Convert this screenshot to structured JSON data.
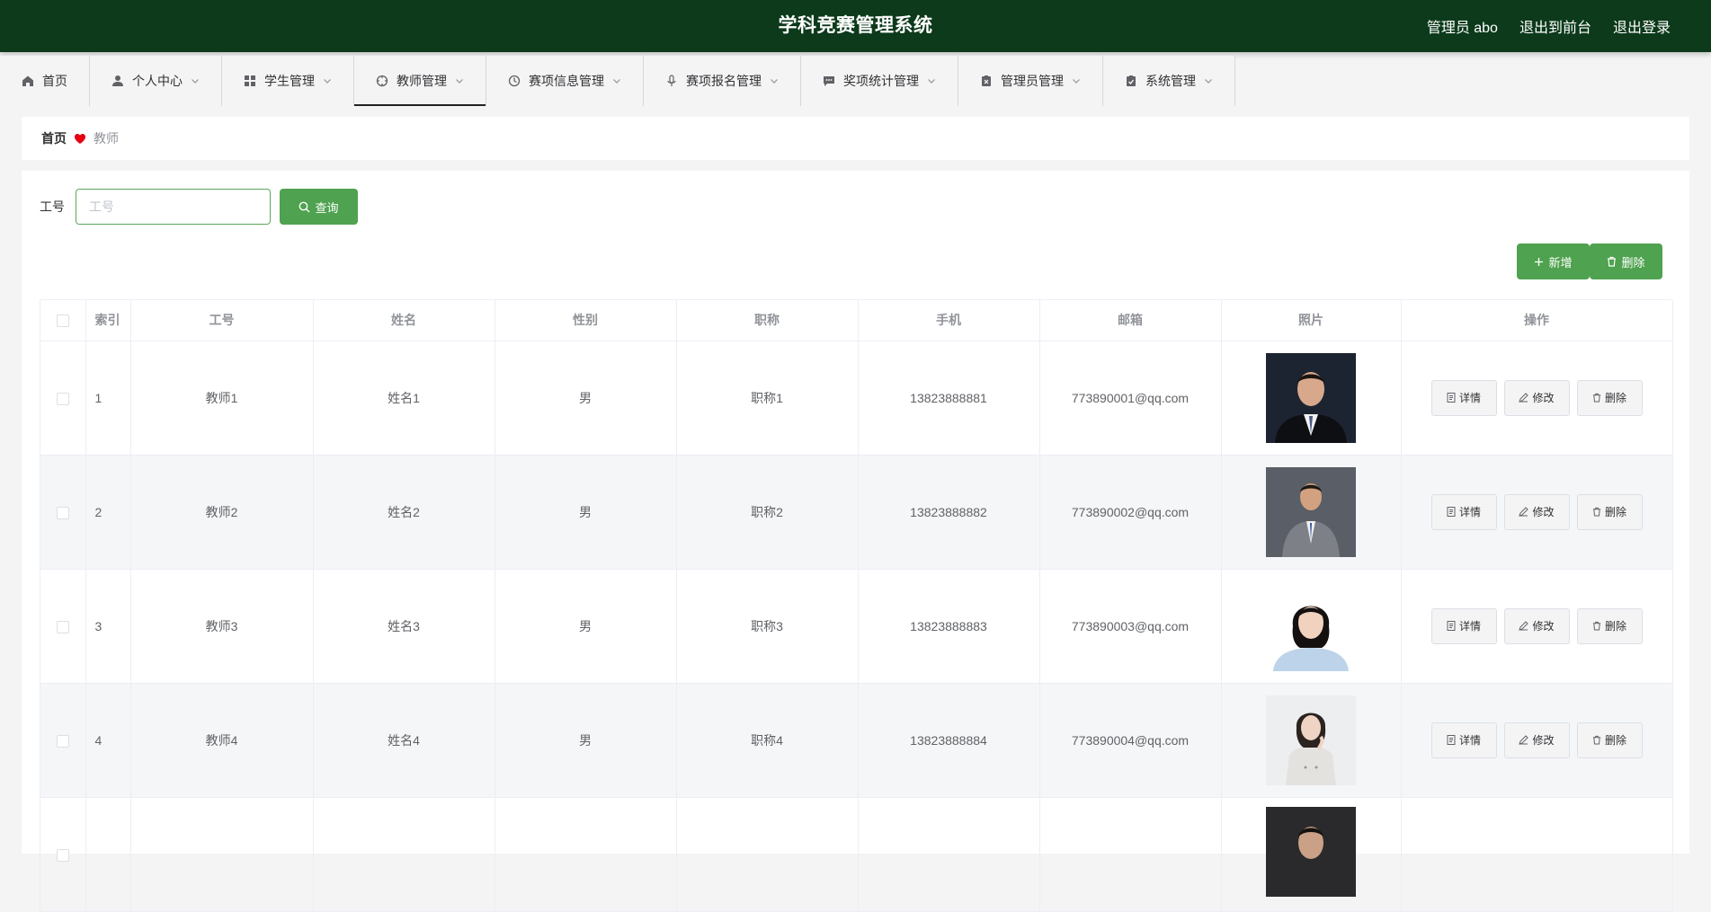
{
  "header": {
    "title": "学科竞赛管理系统",
    "user_label": "管理员 abo",
    "to_front": "退出到前台",
    "logout": "退出登录"
  },
  "nav": {
    "items": [
      {
        "label": "首页",
        "icon": "home-icon"
      },
      {
        "label": "个人中心",
        "icon": "user-icon"
      },
      {
        "label": "学生管理",
        "icon": "grid-icon"
      },
      {
        "label": "教师管理",
        "icon": "compass-icon"
      },
      {
        "label": "赛项信息管理",
        "icon": "clock-icon"
      },
      {
        "label": "赛项报名管理",
        "icon": "microphone-icon"
      },
      {
        "label": "奖项统计管理",
        "icon": "chat-icon"
      },
      {
        "label": "管理员管理",
        "icon": "clipboard-x-icon"
      },
      {
        "label": "系统管理",
        "icon": "clipboard-check-icon"
      }
    ],
    "active_index": 3
  },
  "breadcrumb": {
    "home": "首页",
    "current": "教师"
  },
  "search": {
    "label": "工号",
    "placeholder": "工号",
    "button": "查询"
  },
  "toolbar": {
    "add": "新增",
    "delete": "删除"
  },
  "table": {
    "headers": [
      "索引",
      "工号",
      "姓名",
      "性别",
      "职称",
      "手机",
      "邮箱",
      "照片",
      "操作"
    ],
    "rows": [
      {
        "index": "1",
        "job_no": "教师1",
        "name": "姓名1",
        "gender": "男",
        "title": "职称1",
        "phone": "13823888881",
        "email": "773890001@qq.com"
      },
      {
        "index": "2",
        "job_no": "教师2",
        "name": "姓名2",
        "gender": "男",
        "title": "职称2",
        "phone": "13823888882",
        "email": "773890002@qq.com"
      },
      {
        "index": "3",
        "job_no": "教师3",
        "name": "姓名3",
        "gender": "男",
        "title": "职称3",
        "phone": "13823888883",
        "email": "773890003@qq.com"
      },
      {
        "index": "4",
        "job_no": "教师4",
        "name": "姓名4",
        "gender": "男",
        "title": "职称4",
        "phone": "13823888884",
        "email": "773890004@qq.com"
      }
    ],
    "actions": {
      "detail": "详情",
      "edit": "修改",
      "delete": "删除"
    }
  },
  "colors": {
    "header_bg": "#0c3a1b",
    "accent_green": "#4fa24f",
    "heart_red": "#e60012"
  }
}
